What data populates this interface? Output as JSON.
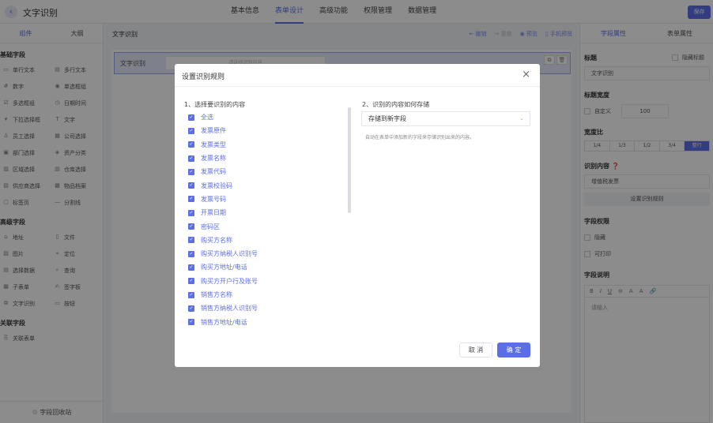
{
  "header": {
    "back_icon": "chevron-left-icon",
    "title": "文字识别",
    "tabs": [
      "基本信息",
      "表单设计",
      "高级功能",
      "权限管理",
      "数据管理"
    ],
    "active_tab": "表单设计",
    "save_label": "保存",
    "accent": "#5b6ee8"
  },
  "left_panel": {
    "tabs": [
      "组件",
      "大纲"
    ],
    "groups": [
      {
        "title": "基础字段",
        "items": [
          "单行文本",
          "多行文本",
          "数字",
          "单选框组",
          "多选框组",
          "日期时间",
          "下拉选择框",
          "文字",
          "员工选择",
          "公司选择",
          "部门选择",
          "资产分类",
          "区域选择",
          "仓库选择",
          "供应商选择",
          "物品档案",
          "标签页",
          "分割线"
        ]
      },
      {
        "title": "高级字段",
        "items": [
          "地址",
          "文件",
          "图片",
          "定位",
          "选择数据",
          "查询",
          "子表单",
          "签字板",
          "文字识别",
          "按钮"
        ]
      },
      {
        "title": "关联字段",
        "items": [
          "关联表单"
        ]
      }
    ],
    "bottom_label": "字段回收站"
  },
  "canvas": {
    "title": "文字识别",
    "actions": [
      "撤销",
      "重做",
      "预览",
      "手机预览"
    ],
    "field_label": "文字识别",
    "field_placeholder": "请选择识别内容"
  },
  "right_panel": {
    "tabs": [
      "字段属性",
      "表单属性"
    ],
    "title_label": "标题",
    "hide_title_label": "隐藏标题",
    "title_value": "文字识别",
    "title_width_label": "标题宽度",
    "custom_label": "自定义",
    "custom_value": "100",
    "width_ratio_label": "宽度比",
    "width_ratio_options": [
      "1/4",
      "1/3",
      "1/2",
      "3/4",
      "整行"
    ],
    "width_ratio_active": "整行",
    "recog_content_label": "识别内容",
    "recog_content_value": "增值税发票",
    "set_rule_button": "设置识别规则",
    "permission_label": "字段权限",
    "hidden_label": "隐藏",
    "printable_label": "可打印",
    "desc_label": "字段说明",
    "desc_placeholder": "请输入"
  },
  "modal": {
    "title": "设置识别规则",
    "section1": "1、选择要识别的内容",
    "section2": "2、识别的内容如何存储",
    "options": [
      "全选",
      "发票原件",
      "发票类型",
      "发票名称",
      "发票代码",
      "发票校验码",
      "发票号码",
      "开票日期",
      "密码区",
      "购买方名称",
      "购买方纳税人识别号",
      "购买方地址/电话",
      "购买方开户行及账号",
      "销售方名称",
      "销售方纳税人识别号",
      "销售方地址/电话"
    ],
    "storage_value": "存储到新字段",
    "hint": "自动在表单中添加新的字段来存储识别出来的内容。",
    "cancel_label": "取 消",
    "ok_label": "确 定"
  }
}
